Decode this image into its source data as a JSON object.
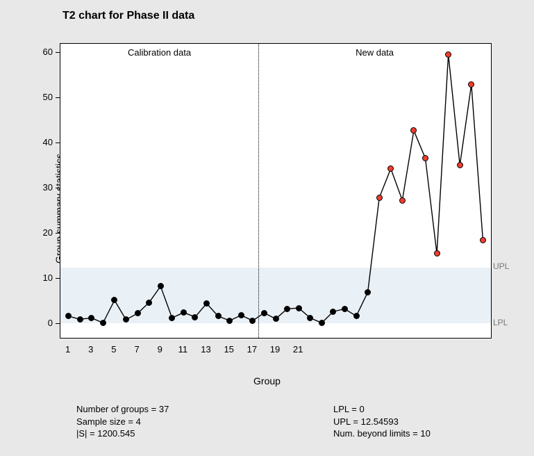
{
  "title": "T2 chart for Phase II data",
  "ylabel": "Group summary statistics",
  "xlabel": "Group",
  "regions": {
    "calibration": "Calibration data",
    "newdata": "New data"
  },
  "limits": {
    "LPL_label": "LPL",
    "UPL_label": "UPL",
    "LPL": 0,
    "UPL": 12.54593
  },
  "xaxis_ticks": [
    1,
    3,
    5,
    7,
    9,
    11,
    13,
    15,
    17,
    19,
    21
  ],
  "yaxis_ticks": [
    0,
    10,
    20,
    30,
    40,
    50,
    60
  ],
  "stats_left": {
    "ngroups": "Number of groups = 37",
    "sample": "Sample size = 4",
    "detS": "|S| = 1200.545"
  },
  "stats_right": {
    "lpl": "LPL = 0",
    "upl": "UPL = 12.54593",
    "beyond": "Num. beyond limits = 10"
  },
  "chart_data": {
    "type": "line",
    "title": "T2 chart for Phase II data",
    "xlabel": "Group",
    "ylabel": "Group summary statistics",
    "xlim": [
      0.3,
      37.7
    ],
    "ylim": [
      -3,
      62
    ],
    "groups": [
      1,
      2,
      3,
      4,
      5,
      6,
      7,
      8,
      9,
      10,
      11,
      12,
      13,
      14,
      15,
      16,
      17,
      18,
      19,
      20,
      21,
      22,
      23,
      24,
      25,
      26,
      27,
      28,
      29,
      30,
      31,
      32,
      33,
      34,
      35,
      36,
      37
    ],
    "values": [
      1.8,
      1.1,
      1.4,
      0.3,
      5.3,
      1.0,
      2.4,
      4.8,
      8.4,
      1.4,
      2.6,
      1.6,
      4.6,
      1.8,
      0.8,
      2.0,
      0.8,
      2.5,
      1.2,
      3.4,
      3.6,
      1.4,
      0.3,
      2.8,
      3.4,
      1.8,
      7.1,
      28.0,
      34.4,
      27.4,
      42.8,
      36.7,
      15.6,
      59.6,
      35.2,
      53.0,
      18.6
    ],
    "phase_split_after_group": 17,
    "UPL": 12.54593,
    "LPL": 0,
    "out_of_control_groups": [
      28,
      29,
      30,
      31,
      32,
      33,
      34,
      35,
      36,
      37
    ]
  }
}
